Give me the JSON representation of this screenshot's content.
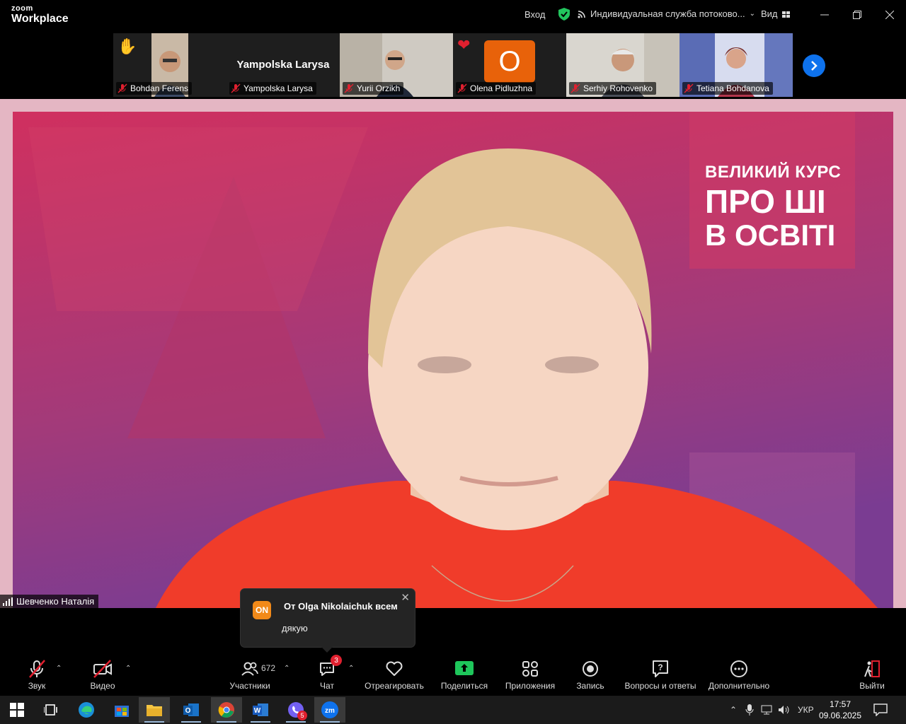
{
  "titlebar": {
    "logo_top": "zoom",
    "logo_bottom": "Workplace",
    "signin": "Вход",
    "stream_service": "Индивидуальная служба потоково...",
    "view": "Вид"
  },
  "participants": [
    {
      "name": "Bohdan Ferens",
      "reaction": "raised-hand"
    },
    {
      "name": "Yampolska Larysa",
      "display_name": "Yampolska Larysa"
    },
    {
      "name": "Yurii Orzikh"
    },
    {
      "name": "Olena Pidluzhna",
      "reaction": "heart",
      "avatar_letter": "O"
    },
    {
      "name": "Serhiy Rohovenko"
    },
    {
      "name": "Tetiana Bohdanova"
    }
  ],
  "main": {
    "speaker": "Шевченко Наталія",
    "banner": {
      "line1": "ВЕЛИКИЙ КУРС",
      "line2": "ПРО ШІ",
      "line3": "В ОСВІТІ"
    }
  },
  "chat_toast": {
    "avatar_initials": "ON",
    "from": "От Olga Nikolaichuk всем",
    "message": "дякую"
  },
  "toolbar": {
    "audio": "Звук",
    "video": "Видео",
    "participants": "Участники",
    "participants_count": "672",
    "chat": "Чат",
    "chat_badge": "3",
    "react": "Отреагировать",
    "share": "Поделиться",
    "apps": "Приложения",
    "record": "Запись",
    "qa": "Вопросы и ответы",
    "more": "Дополнительно",
    "leave": "Выйти"
  },
  "taskbar": {
    "viber_badge": "5",
    "language": "УКР",
    "time": "17:57",
    "date": "09.06.2025"
  },
  "colors": {
    "zoom_blue": "#0e72ed",
    "share_green": "#1ec65b",
    "muted_red": "#e0202f",
    "toast_avatar": "#f28a19",
    "banner_pink": "#c8305e"
  }
}
